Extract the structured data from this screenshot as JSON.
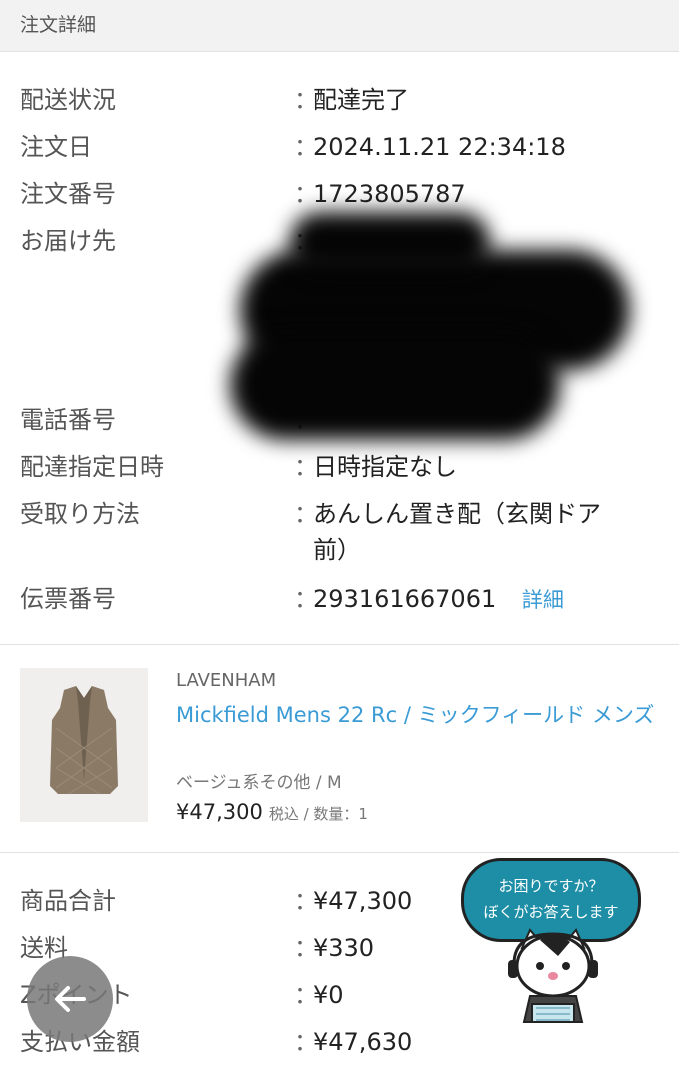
{
  "header": {
    "title": "注文詳細"
  },
  "order": {
    "rows": [
      {
        "label": "配送状況",
        "value": "配達完了"
      },
      {
        "label": "注文日",
        "value": "2024.11.21 22:34:18"
      },
      {
        "label": "注文番号",
        "value": "1723805787"
      },
      {
        "label": "お届け先",
        "value": ""
      },
      {
        "label": "電話番号",
        "value": ""
      },
      {
        "label": "配達指定日時",
        "value": "日時指定なし"
      },
      {
        "label": "受取り方法",
        "value": "あんしん置き配（玄関ドア前）"
      },
      {
        "label": "伝票番号",
        "value": "293161667061",
        "link": "詳細"
      }
    ],
    "colon": "："
  },
  "product": {
    "brand": "LAVENHAM",
    "name": "Mickfield Mens 22 Rc / ミックフィールド メンズ",
    "variant": "ベージュ系その他 / M",
    "price": "¥47,300",
    "price_note": "税込 / 数量：1"
  },
  "totals": {
    "rows": [
      {
        "label": "商品合計",
        "value": "¥47,300"
      },
      {
        "label": "送料",
        "value": "¥330"
      },
      {
        "label": "Zポイント",
        "value": "¥0"
      },
      {
        "label": "支払い金額",
        "value": "¥47,630"
      }
    ]
  },
  "helper": {
    "line1": "お困りですか？",
    "line2": "ぼくがお答えします"
  },
  "colors": {
    "link": "#3a9bd5",
    "helper_bubble": "#1e8ea6",
    "header_bg": "#f2f2f2"
  },
  "icons": {
    "back": "arrow-left-icon",
    "helper": "cat-headset-icon"
  }
}
